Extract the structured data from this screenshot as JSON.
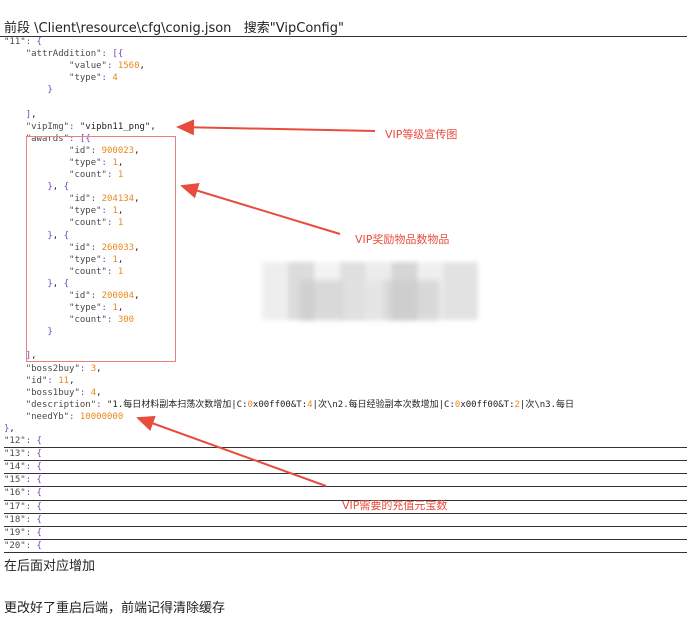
{
  "title": "前段 \\Client\\resource\\cfg\\conig.json   搜索\"VipConfig\"",
  "code_lines": [
    {
      "k": "\"11\": {",
      "cls": "p"
    },
    {
      "k": "    \"attrAddition\": [{",
      "cls": "k"
    },
    {
      "k": "            \"value\": 1560,",
      "cls": "k"
    },
    {
      "k": "            \"type\": 4",
      "cls": "k"
    },
    {
      "k": "        }",
      "cls": "p"
    },
    {
      "k": "",
      "cls": "k"
    },
    {
      "k": "    ],",
      "cls": "p"
    },
    {
      "k": "    \"vipImg\": \"vipbn11_png\",",
      "cls": "k"
    },
    {
      "k": "    \"awards\": [{",
      "cls": "k"
    },
    {
      "k": "            \"id\": 900023,",
      "cls": "k"
    },
    {
      "k": "            \"type\": 1,",
      "cls": "k"
    },
    {
      "k": "            \"count\": 1",
      "cls": "k"
    },
    {
      "k": "        }, {",
      "cls": "p"
    },
    {
      "k": "            \"id\": 204134,",
      "cls": "k"
    },
    {
      "k": "            \"type\": 1,",
      "cls": "k"
    },
    {
      "k": "            \"count\": 1",
      "cls": "k"
    },
    {
      "k": "        }, {",
      "cls": "p"
    },
    {
      "k": "            \"id\": 260033,",
      "cls": "k"
    },
    {
      "k": "            \"type\": 1,",
      "cls": "k"
    },
    {
      "k": "            \"count\": 1",
      "cls": "k"
    },
    {
      "k": "        }, {",
      "cls": "p"
    },
    {
      "k": "            \"id\": 200004,",
      "cls": "k"
    },
    {
      "k": "            \"type\": 1,",
      "cls": "k"
    },
    {
      "k": "            \"count\": 300",
      "cls": "k"
    },
    {
      "k": "        }",
      "cls": "p"
    },
    {
      "k": "",
      "cls": "k"
    },
    {
      "k": "    ],",
      "cls": "p"
    },
    {
      "k": "    \"boss2buy\": 3,",
      "cls": "k"
    },
    {
      "k": "    \"id\": 11,",
      "cls": "k"
    },
    {
      "k": "    \"boss1buy\": 4,",
      "cls": "k"
    },
    {
      "k": "    \"description\": \"1.每日材料副本扫荡次数增加|C:0x00ff00&T:4|次\\n2.每日经验副本次数增加|C:0x00ff00&T:2|次\\n3.每日",
      "cls": "k"
    },
    {
      "k": "    \"needYb\": 10000000",
      "cls": "k"
    },
    {
      "k": "},",
      "cls": "p"
    },
    {
      "k": "\"12\": {",
      "cls": "p",
      "box": true
    },
    {
      "k": "\"13\": {",
      "cls": "p",
      "box": true
    },
    {
      "k": "\"14\": {",
      "cls": "p",
      "box": true
    },
    {
      "k": "\"15\": {",
      "cls": "p",
      "box": true
    },
    {
      "k": "\"16\": {",
      "cls": "p",
      "box": true
    },
    {
      "k": "\"17\": {",
      "cls": "p",
      "box": true
    },
    {
      "k": "\"18\": {",
      "cls": "p",
      "box": true
    },
    {
      "k": "\"19\": {",
      "cls": "p",
      "box": true
    },
    {
      "k": "\"20\": {",
      "cls": "p",
      "box": true
    }
  ],
  "annotations": {
    "vip_img": "VIP等级宣传图",
    "awards": "VIP奖励物品数物品",
    "need_yb": "VIP需要的充值元宝数"
  },
  "footer": {
    "line1": "在后面对应增加",
    "line2": "更改好了重启后端，前端记得清除缓存"
  },
  "colors": {
    "annotation": "#e84c3d",
    "key": "#4a4a4a",
    "number": "#e8891a",
    "punct": "#7a42b8"
  }
}
